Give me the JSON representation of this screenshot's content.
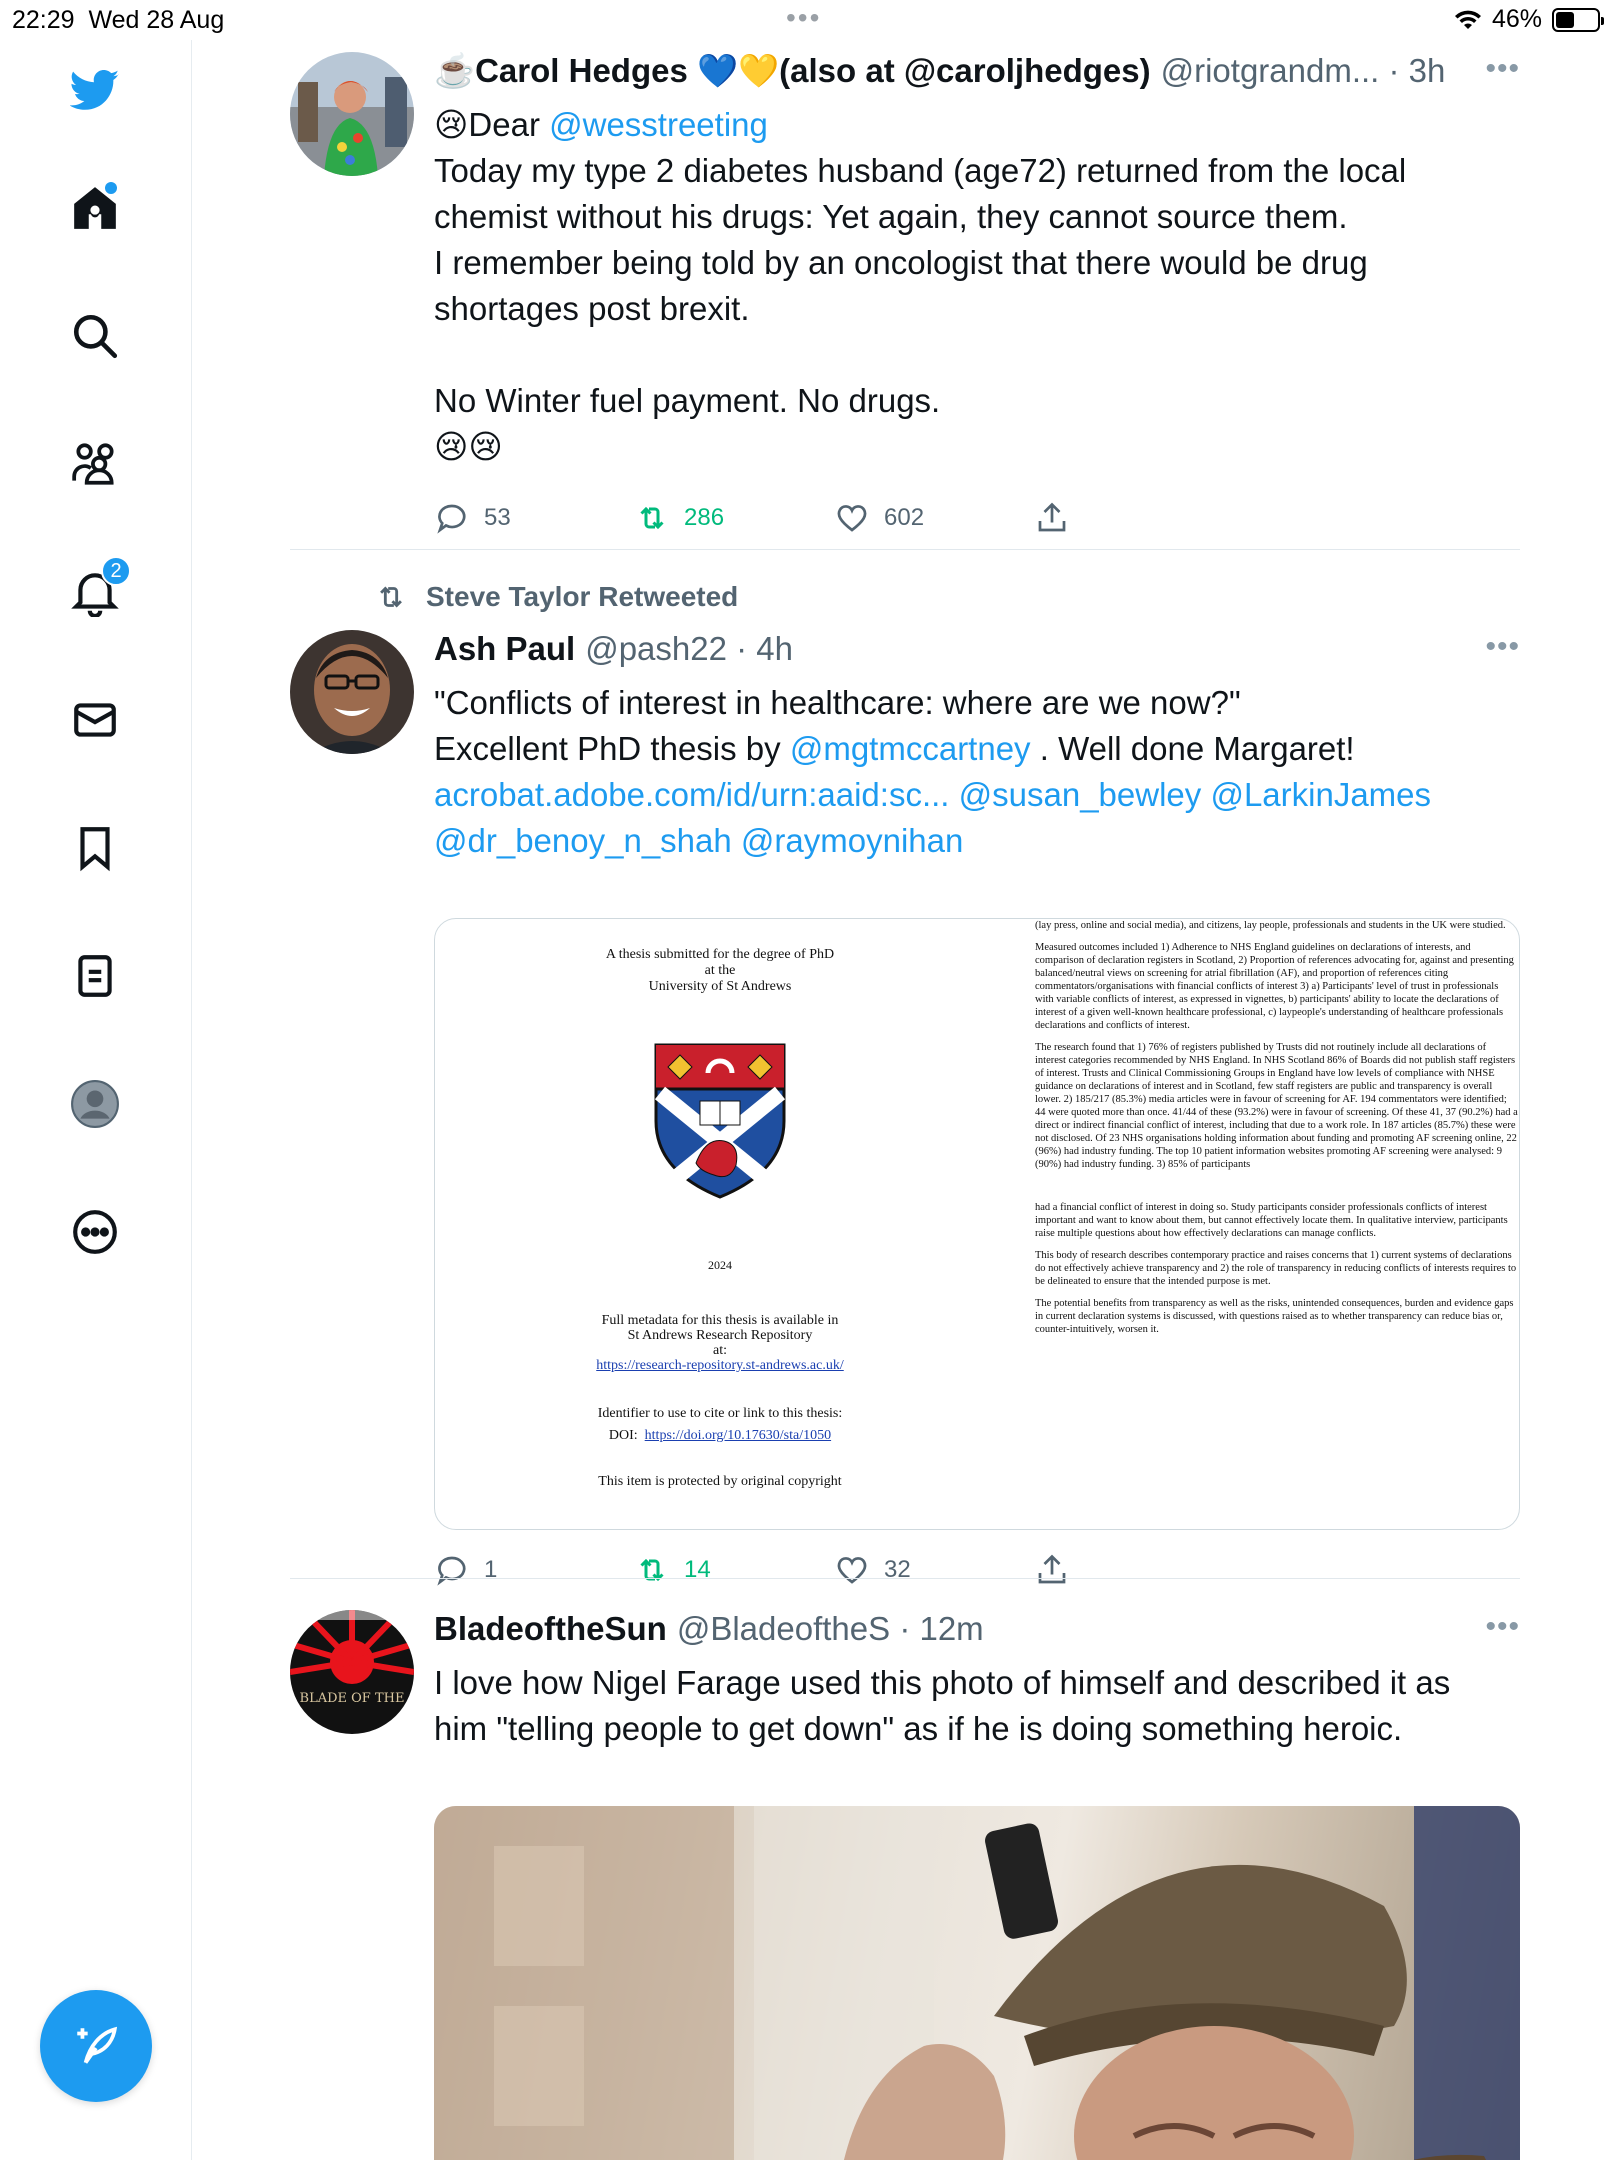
{
  "status_bar": {
    "time": "22:29",
    "date": "Wed 28 Aug",
    "battery": "46%",
    "battery_level": 0.46,
    "dots": "•••"
  },
  "sidebar": {
    "items": [
      {
        "icon": "twitter-bird-icon"
      },
      {
        "icon": "home-icon",
        "dot": true
      },
      {
        "icon": "search-icon"
      },
      {
        "icon": "communities-icon"
      },
      {
        "icon": "notifications-icon",
        "badge": "2"
      },
      {
        "icon": "messages-icon"
      },
      {
        "icon": "bookmarks-icon"
      },
      {
        "icon": "lists-icon"
      },
      {
        "icon": "profile-icon"
      },
      {
        "icon": "more-icon"
      }
    ],
    "compose_icon": "compose-icon"
  },
  "tweets": [
    {
      "name": "☕️Carol Hedges 💙💛(also at @caroljhedges)",
      "handle": "@riotgrandm... · 3h",
      "text_intro": "😢Dear ",
      "mention": "@wesstreeting",
      "text": "Today my type 2 diabetes husband (age72) returned from the local\nchemist without his drugs: Yet again, they cannot source them.\nI remember being told by an oncologist that there would be drug\nshortages post brexit.\n\nNo Winter fuel payment. No drugs.\n😢😢",
      "replies": "53",
      "retweets": "286",
      "likes": "602",
      "more": "•••"
    },
    {
      "retweeted_by": "Steve Taylor Retweeted",
      "name": "Ash Paul",
      "handle": "@pash22 · 4h",
      "line1": "\"Conflicts of interest in healthcare: where are we now?\"",
      "line2_pre": "Excellent PhD thesis by ",
      "line2_mention": "@mgtmccartney",
      "line2_post": " . Well done Margaret!",
      "link1": "acrobat.adobe.com/id/urn:aaid:sc...",
      "link2": "@susan_bewley",
      "link3": "@LarkinJames",
      "link4": "@dr_benoy_n_shah",
      "link5": "@raymoynihan",
      "doc": {
        "left_title": "A thesis submitted for the degree of PhD\nat the\nUniversity of St Andrews",
        "year": "2024",
        "metadata": "Full metadata for this thesis is available in\nSt Andrews Research Repository\nat:",
        "repo_url": "https://research-repository.st-andrews.ac.uk/",
        "identifier": "Identifier to use to cite or link to this thesis:",
        "doi_label": "DOI:",
        "doi_url": "https://doi.org/10.17630/sta/1050",
        "copyright": "This item is protected by original copyright",
        "right_p1": "(lay press, online and social media), and citizens, lay people, professionals and students in the UK were studied.",
        "right_p2": "Measured outcomes included 1) Adherence to NHS England guidelines on declarations of interests, and comparison of declaration registers in Scotland, 2) Proportion of references advocating for, against and presenting balanced/neutral views on screening for atrial fibrillation (AF), and proportion of references citing commentators/organisations with financial conflicts of interest 3) a) Participants' level of trust in professionals with variable conflicts of interest, as expressed in vignettes, b) participants' ability to locate the declarations of interest of a given well-known healthcare professional, c) laypeople's understanding of healthcare professionals declarations and conflicts of interest.",
        "right_p3": "The research found that 1) 76% of registers published by Trusts did not routinely include all declarations of interest categories recommended by NHS England. In NHS Scotland 86% of Boards did not publish staff registers of interest. Trusts and Clinical Commissioning Groups in England have low levels of compliance with NHSE guidance on declarations of interest and in Scotland, few staff registers are public and transparency is overall lower. 2) 185/217 (85.3%) media articles were in favour of screening for AF. 194 commentators were identified; 44 were quoted more than once. 41/44 of these (93.2%) were in favour of screening. Of these 41, 37 (90.2%) had a direct or indirect financial conflict of interest, including that due to a work role. In 187 articles (85.7%) these were not disclosed. Of 23 NHS organisations holding information about funding and promoting AF screening online, 22 (96%) had industry funding. The top 10 patient information websites promoting AF screening were analysed: 9 (90%) had industry funding. 3) 85% of participants",
        "right_p4": "had a financial conflict of interest in doing so. Study participants consider professionals conflicts of interest important and want to know about them, but cannot effectively locate them. In qualitative interview, participants raise multiple questions about how effectively declarations can manage conflicts.",
        "right_p5": "This body of research describes contemporary practice and raises concerns that 1) current systems of declarations do not effectively achieve transparency and 2) the role of transparency in reducing conflicts of interests requires to be delineated to ensure that the intended purpose is met.",
        "right_p6": "The potential benefits from transparency as well as the risks, unintended consequences, burden and evidence gaps in current declaration systems is discussed, with questions raised as to whether transparency can reduce bias or, counter-intuitively, worsen it."
      },
      "replies": "1",
      "retweets": "14",
      "likes": "32",
      "more": "•••"
    },
    {
      "name": "BladeoftheSun",
      "handle": "@BladeoftheS · 12m",
      "text": "I love how Nigel Farage used this photo of himself and described it as\nhim \"telling people to get down\" as if he is doing something heroic.",
      "avatar_text": "BLADE OF THE",
      "more": "•••"
    }
  ],
  "colors": {
    "accent": "#1d9bf0",
    "retweet": "#00ba7c",
    "muted": "#536471"
  }
}
